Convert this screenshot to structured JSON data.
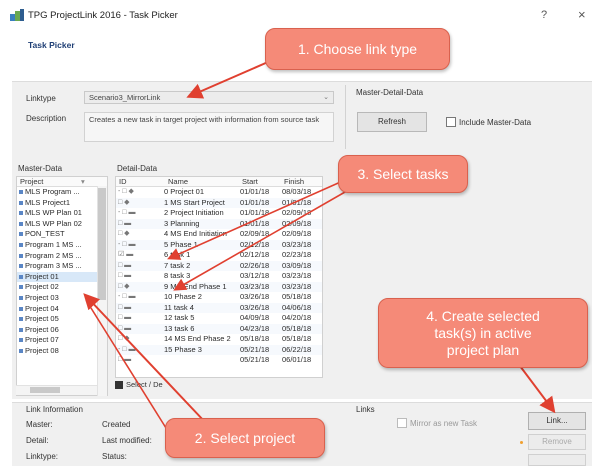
{
  "window": {
    "title": "TPG ProjectLink 2016 - Task Picker",
    "help": "?",
    "close": "×",
    "subtitle": "Task Picker"
  },
  "top": {
    "linktype_label": "Linktype",
    "linktype_value": "Scenario3_MirrorLink",
    "description_label": "Description",
    "description_text": "Creates a new task in target project with information from source task",
    "master_detail_label": "Master-Detail-Data",
    "refresh_label": "Refresh",
    "include_master_label": "Include Master-Data"
  },
  "master": {
    "section_label": "Master-Data",
    "col_project": "Project",
    "items": [
      "MLS Program ...",
      "MLS Project1",
      "MLS WP Plan 01",
      "MLS WP Plan 02",
      "PON_TEST",
      "Program 1 MS ...",
      "Program 2 MS ...",
      "Program 3 MS ...",
      "Project 01",
      "Project 02",
      "Project 03",
      "Project 04",
      "Project 05",
      "Project 06",
      "Project 07",
      "Project 08"
    ],
    "selected_index": 8
  },
  "detail": {
    "section_label": "Detail-Data",
    "col_id": "ID",
    "col_name": "Name",
    "col_start": "Start",
    "col_finish": "Finish",
    "rows": [
      {
        "tree": "- □ ◆",
        "name": "0 Project 01",
        "start": "01/01/18",
        "finish": "08/03/18"
      },
      {
        "tree": "   □ ◆",
        "name": "1 MS Start Project",
        "start": "01/01/18",
        "finish": "01/01/18"
      },
      {
        "tree": " - □ ▬",
        "name": "2 Project Initiation",
        "start": "01/01/18",
        "finish": "02/09/18"
      },
      {
        "tree": "   □ ▬",
        "name": "3 Planning",
        "start": "01/01/18",
        "finish": "02/09/18"
      },
      {
        "tree": "   □ ◆",
        "name": "4 MS End Initiation",
        "start": "02/09/18",
        "finish": "02/09/18"
      },
      {
        "tree": " - □ ▬",
        "name": "5 Phase 1",
        "start": "02/12/18",
        "finish": "03/23/18"
      },
      {
        "tree": "   ☑ ▬",
        "name": "6 task 1",
        "start": "02/12/18",
        "finish": "02/23/18"
      },
      {
        "tree": "   □ ▬",
        "name": "7 task 2",
        "start": "02/26/18",
        "finish": "03/09/18"
      },
      {
        "tree": "   □ ▬",
        "name": "8 task 3",
        "start": "03/12/18",
        "finish": "03/23/18"
      },
      {
        "tree": "   □ ◆",
        "name": "9 MS End Phase 1",
        "start": "03/23/18",
        "finish": "03/23/18"
      },
      {
        "tree": " - □ ▬",
        "name": "10 Phase 2",
        "start": "03/26/18",
        "finish": "05/18/18"
      },
      {
        "tree": "   □ ▬",
        "name": "11 task 4",
        "start": "03/26/18",
        "finish": "04/06/18"
      },
      {
        "tree": "   □ ▬",
        "name": "12 task 5",
        "start": "04/09/18",
        "finish": "04/20/18"
      },
      {
        "tree": "   □ ▬",
        "name": "13 task 6",
        "start": "04/23/18",
        "finish": "05/18/18"
      },
      {
        "tree": "   □ ◆",
        "name": "14 MS End Phase 2",
        "start": "05/18/18",
        "finish": "05/18/18"
      },
      {
        "tree": " - □ ▬",
        "name": "15 Phase 3",
        "start": "05/21/18",
        "finish": "06/22/18"
      },
      {
        "tree": "   □ ▬",
        "name": "",
        "start": "05/21/18",
        "finish": "06/01/18"
      }
    ],
    "select_all_label": "Select / De"
  },
  "bottom": {
    "link_info_label": "Link Information",
    "master_label": "Master:",
    "detail_label": "Detail:",
    "linktype_label": "Linktype:",
    "created_label": "Created",
    "last_modified_label": "Last modified:",
    "status_label": "Status:",
    "links_label": "Links",
    "mirror_label": "Mirror as new Task",
    "link_button": "Link...",
    "remove_button": "Remove"
  },
  "callouts": {
    "step1": "1. Choose link type",
    "step2": "2. Select project",
    "step3": "3. Select tasks",
    "step4_line1": "4. Create selected",
    "step4_line2": "task(s) in active",
    "step4_line3": "project plan"
  },
  "colors": {
    "callout_fill": "#f58a78",
    "callout_border": "#d9614e",
    "arrow": "#e04030",
    "panel": "#f0f0f0",
    "title_blue": "#1f3f75"
  }
}
